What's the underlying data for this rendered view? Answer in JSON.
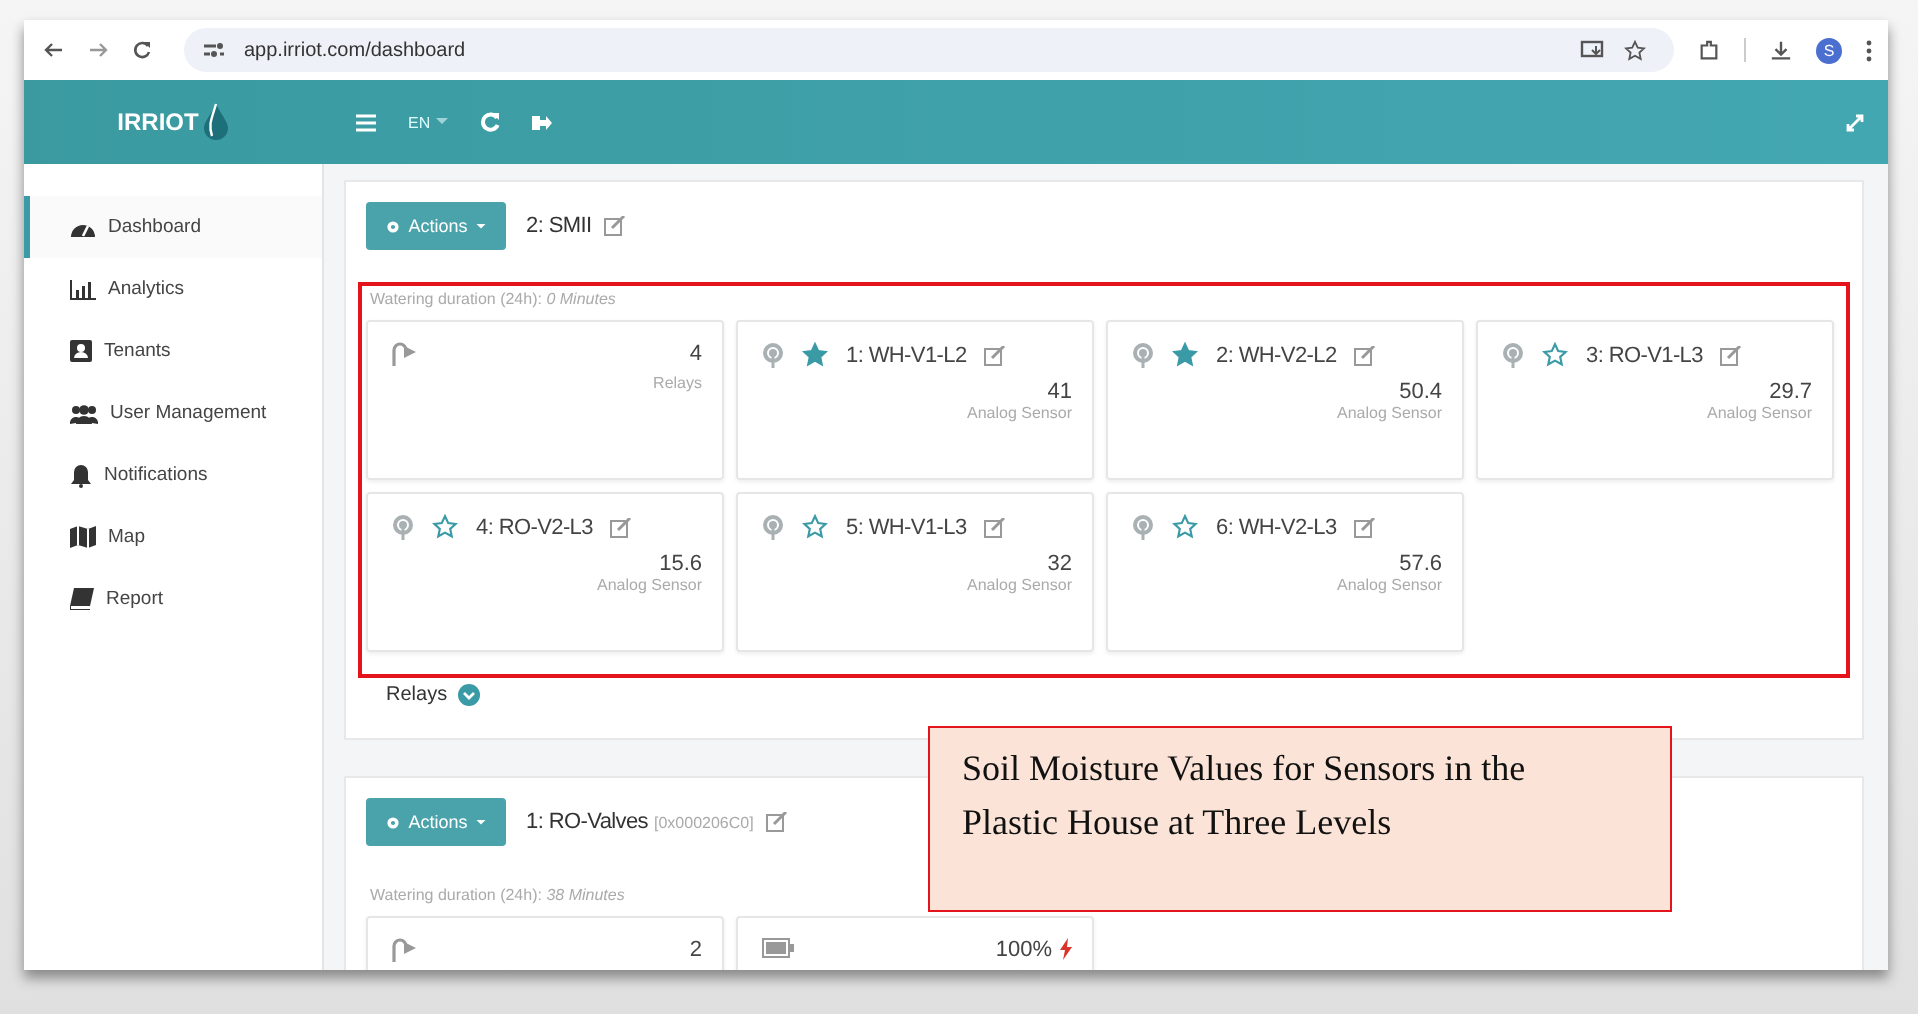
{
  "browser": {
    "url": "app.irriot.com/dashboard",
    "profile_initial": "S"
  },
  "header": {
    "brand": "IRRIOT",
    "language": "EN"
  },
  "sidebar": {
    "items": [
      {
        "label": "Dashboard",
        "selected": true
      },
      {
        "label": "Analytics",
        "selected": false
      },
      {
        "label": "Tenants",
        "selected": false
      },
      {
        "label": "User Management",
        "selected": false
      },
      {
        "label": "Notifications",
        "selected": false
      },
      {
        "label": "Map",
        "selected": false
      },
      {
        "label": "Report",
        "selected": false
      }
    ]
  },
  "groups": [
    {
      "actions": "Actions",
      "title": "2: SMII",
      "watering_label": "Watering duration (24h):",
      "watering_value": "0 Minutes",
      "footer": "Relays",
      "devices": [
        {
          "kind": "relays",
          "value": "4",
          "caption": "Relays"
        },
        {
          "kind": "sensor",
          "name": "1: WH-V1-L2",
          "starred": true,
          "value": "41",
          "caption": "Analog Sensor"
        },
        {
          "kind": "sensor",
          "name": "2: WH-V2-L2",
          "starred": true,
          "value": "50.4",
          "caption": "Analog Sensor"
        },
        {
          "kind": "sensor",
          "name": "3: RO-V1-L3",
          "starred": false,
          "value": "29.7",
          "caption": "Analog Sensor"
        },
        {
          "kind": "sensor",
          "name": "4: RO-V2-L3",
          "starred": false,
          "value": "15.6",
          "caption": "Analog Sensor"
        },
        {
          "kind": "sensor",
          "name": "5: WH-V1-L3",
          "starred": false,
          "value": "32",
          "caption": "Analog Sensor"
        },
        {
          "kind": "sensor",
          "name": "6: WH-V2-L3",
          "starred": false,
          "value": "57.6",
          "caption": "Analog Sensor"
        }
      ]
    },
    {
      "actions": "Actions",
      "title": "1: RO-Valves",
      "address": "[0x000206C0]",
      "watering_label": "Watering duration (24h):",
      "watering_value": "38 Minutes",
      "devices": [
        {
          "kind": "relays",
          "value": "2"
        },
        {
          "kind": "battery",
          "value": "100%"
        }
      ]
    }
  ],
  "annotation": {
    "text": "Soil Moisture Values for Sensors in the Plastic House at Three Levels"
  }
}
